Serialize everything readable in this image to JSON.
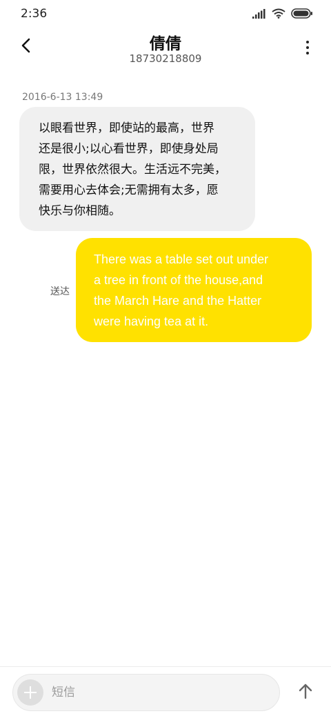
{
  "status_bar": {
    "time": "2:36",
    "icons": [
      "signal-icon",
      "wifi-icon",
      "battery-icon"
    ]
  },
  "header": {
    "contact_name": "倩倩",
    "phone_number": "18730218809",
    "back_icon": "chevron-left-icon",
    "menu_icon": "more-vertical-icon"
  },
  "conversation": {
    "timestamp": "2016-6-13 13:49",
    "incoming": {
      "lines": [
        "以眼看世界，即使站的最高，世界",
        "还是很小;以心看世界，即使身处局",
        "限，世界依然很大。生活远不完美，",
        "需要用心去体会;无需拥有太多，愿",
        "快乐与你相随。"
      ]
    },
    "outgoing": {
      "status": "送达",
      "lines": [
        "There was a table set out under",
        "a tree in front of the house,and",
        "the March Hare and the Hatter",
        "were having tea at it."
      ],
      "bubble_color": "#ffe100"
    }
  },
  "compose": {
    "placeholder": "短信",
    "add_icon": "plus-icon",
    "send_icon": "arrow-up-icon"
  }
}
